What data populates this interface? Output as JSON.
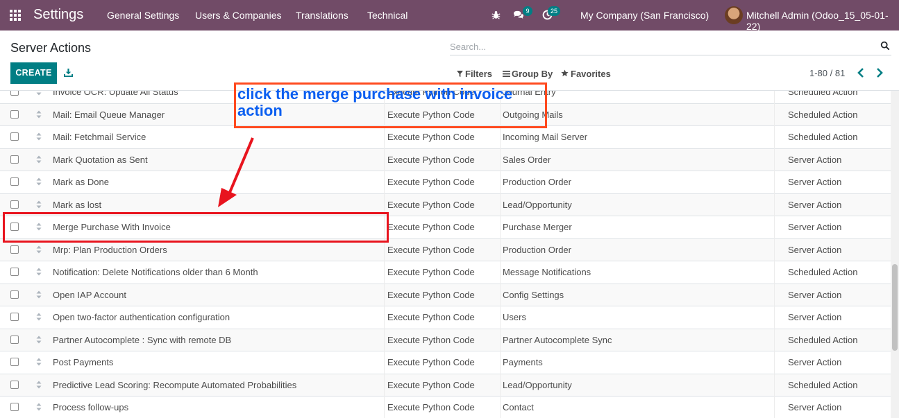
{
  "topbar": {
    "app_title": "Settings",
    "menu": [
      "General Settings",
      "Users & Companies",
      "Translations",
      "Technical"
    ],
    "chat_count": "9",
    "activity_count": "25",
    "company": "My Company (San Francisco)",
    "user": "Mitchell Admin (Odoo_15_05-01-22)",
    "colors": {
      "bar": "#714B67",
      "badge": "#017e84"
    }
  },
  "control": {
    "title": "Server Actions",
    "search_placeholder": "Search...",
    "create_label": "CREATE",
    "filters_label": "Filters",
    "groupby_label": "Group By",
    "favorites_label": "Favorites",
    "pager": "1-80 / 81"
  },
  "rows": [
    {
      "name": "Invoice OCR: Update All Status",
      "action": "Execute Python Code",
      "model": "Journal Entry",
      "usage": "Scheduled Action"
    },
    {
      "name": "Mail: Email Queue Manager",
      "action": "Execute Python Code",
      "model": "Outgoing Mails",
      "usage": "Scheduled Action"
    },
    {
      "name": "Mail: Fetchmail Service",
      "action": "Execute Python Code",
      "model": "Incoming Mail Server",
      "usage": "Scheduled Action"
    },
    {
      "name": "Mark Quotation as Sent",
      "action": "Execute Python Code",
      "model": "Sales Order",
      "usage": "Server Action"
    },
    {
      "name": "Mark as Done",
      "action": "Execute Python Code",
      "model": "Production Order",
      "usage": "Server Action"
    },
    {
      "name": "Mark as lost",
      "action": "Execute Python Code",
      "model": "Lead/Opportunity",
      "usage": "Server Action"
    },
    {
      "name": "Merge Purchase With Invoice",
      "action": "Execute Python Code",
      "model": "Purchase Merger",
      "usage": "Server Action"
    },
    {
      "name": "Mrp: Plan Production Orders",
      "action": "Execute Python Code",
      "model": "Production Order",
      "usage": "Server Action"
    },
    {
      "name": "Notification: Delete Notifications older than 6 Month",
      "action": "Execute Python Code",
      "model": "Message Notifications",
      "usage": "Scheduled Action"
    },
    {
      "name": "Open IAP Account",
      "action": "Execute Python Code",
      "model": "Config Settings",
      "usage": "Server Action"
    },
    {
      "name": "Open two-factor authentication configuration",
      "action": "Execute Python Code",
      "model": "Users",
      "usage": "Server Action"
    },
    {
      "name": "Partner Autocomplete : Sync with remote DB",
      "action": "Execute Python Code",
      "model": "Partner Autocomplete Sync",
      "usage": "Scheduled Action"
    },
    {
      "name": "Post Payments",
      "action": "Execute Python Code",
      "model": "Payments",
      "usage": "Server Action"
    },
    {
      "name": "Predictive Lead Scoring: Recompute Automated Probabilities",
      "action": "Execute Python Code",
      "model": "Lead/Opportunity",
      "usage": "Scheduled Action"
    },
    {
      "name": "Process follow-ups",
      "action": "Execute Python Code",
      "model": "Contact",
      "usage": "Server Action"
    }
  ],
  "annotation": {
    "text": "click the merge purchase with invoice action",
    "text_color": "#0a5ef0",
    "box_color": "#ff4a1f",
    "highlight_color": "#e8141e"
  }
}
